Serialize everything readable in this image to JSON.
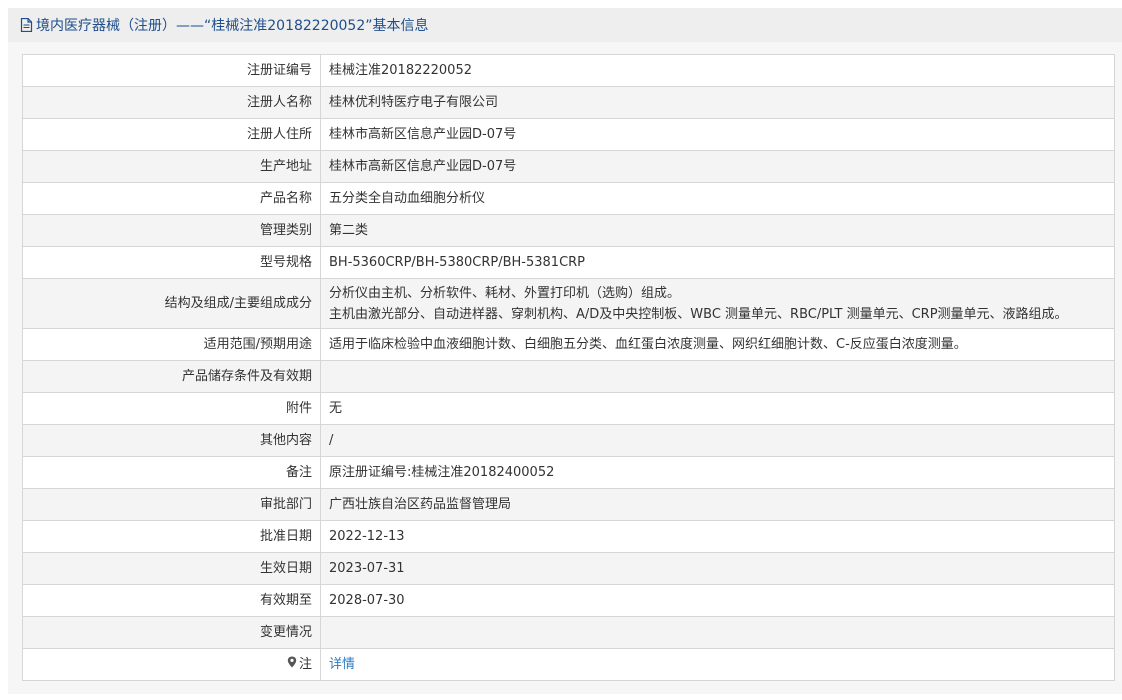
{
  "header": {
    "title": "境内医疗器械（注册）——“桂械注准20182220052”基本信息"
  },
  "rows": [
    {
      "label": "注册证编号",
      "value": "桂械注准20182220052"
    },
    {
      "label": "注册人名称",
      "value": "桂林优利特医疗电子有限公司"
    },
    {
      "label": "注册人住所",
      "value": "桂林市高新区信息产业园D-07号"
    },
    {
      "label": "生产地址",
      "value": "桂林市高新区信息产业园D-07号"
    },
    {
      "label": "产品名称",
      "value": "五分类全自动血细胞分析仪"
    },
    {
      "label": "管理类别",
      "value": "第二类"
    },
    {
      "label": "型号规格",
      "value": "BH-5360CRP/BH-5380CRP/BH-5381CRP"
    },
    {
      "label": "结构及组成/主要组成成分",
      "value_line1": "分析仪由主机、分析软件、耗材、外置打印机（选购）组成。",
      "value_line2": "主机由激光部分、自动进样器、穿刺机构、A/D及中央控制板、WBC 测量单元、RBC/PLT 测量单元、CRP测量单元、液路组成。"
    },
    {
      "label": "适用范围/预期用途",
      "value": "适用于临床检验中血液细胞计数、白细胞五分类、血红蛋白浓度测量、网织红细胞计数、C-反应蛋白浓度测量。"
    },
    {
      "label": "产品储存条件及有效期",
      "value": ""
    },
    {
      "label": "附件",
      "value": "无"
    },
    {
      "label": "其他内容",
      "value": "/"
    },
    {
      "label": "备注",
      "value": "原注册证编号:桂械注准20182400052"
    },
    {
      "label": "审批部门",
      "value": "广西壮族自治区药品监督管理局"
    },
    {
      "label": "批准日期",
      "value": "2022-12-13"
    },
    {
      "label": "生效日期",
      "value": "2023-07-31"
    },
    {
      "label": "有效期至",
      "value": "2028-07-30"
    },
    {
      "label": "变更情况",
      "value": ""
    },
    {
      "label": "注",
      "value": "详情",
      "icon": "map-pin-icon"
    }
  ],
  "colors": {
    "header_text": "#1f4e8c",
    "link": "#2a7ac7",
    "border": "#d6d6d6",
    "stripe": "#f4f4f4"
  }
}
